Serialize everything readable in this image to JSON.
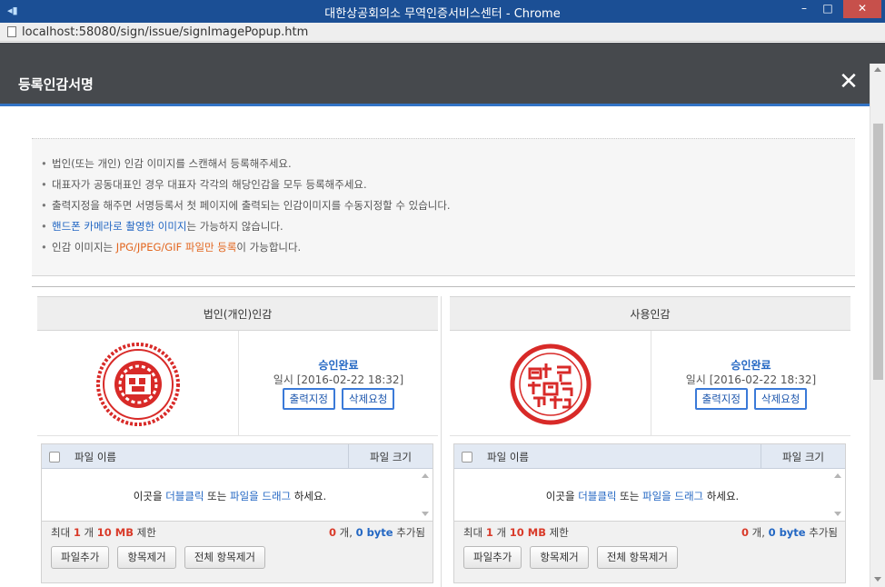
{
  "window": {
    "title": "대한상공회의소 무역인증서비스센터 - Chrome",
    "url": "localhost:58080/sign/issue/signImagePopup.htm",
    "min_glyph": "–",
    "max_glyph": "□",
    "close_glyph": "✕"
  },
  "popup": {
    "title": "등록인감서명",
    "close_glyph": "✕"
  },
  "notice": [
    {
      "parts": [
        {
          "t": "법인(또는 개인) 인감 이미지를 스캔해서 등록해주세요.",
          "c": ""
        }
      ]
    },
    {
      "parts": [
        {
          "t": "대표자가 공동대표인 경우 대표자 각각의 해당인감을 모두 등록해주세요.",
          "c": ""
        }
      ]
    },
    {
      "parts": [
        {
          "t": "출력지정을 해주면 서명등록서 첫 페이지에 출력되는 인감이미지를 수동지정할 수 있습니다.",
          "c": ""
        }
      ]
    },
    {
      "parts": [
        {
          "t": "핸드폰 카메라로 촬영한 이미지",
          "c": "blue"
        },
        {
          "t": "는 가능하지 않습니다.",
          "c": ""
        }
      ]
    },
    {
      "parts": [
        {
          "t": "인감 이미지는 ",
          "c": ""
        },
        {
          "t": "JPG/JPEG/GIF 파일만 등록",
          "c": "orange"
        },
        {
          "t": "이 가능합니다.",
          "c": ""
        }
      ]
    }
  ],
  "panels": [
    {
      "heading": "법인(개인)인감",
      "status": "승인완료",
      "datetime": "일시 [2016-02-22 18:32]",
      "print_button": "출력지정",
      "delete_button": "삭제요청",
      "file_table": {
        "col_name": "파일 이름",
        "col_size": "파일 크기",
        "drop_prefix": "이곳을 ",
        "drop_dblclick": "더블클릭",
        "drop_mid": " 또는 ",
        "drop_drag": "파일을 드래그",
        "drop_suffix": " 하세요.",
        "limit_prefix": "최대 ",
        "limit_count": "1",
        "limit_mid": " 개 ",
        "limit_size": "10 MB",
        "limit_suffix": " 제한",
        "added_count": "0",
        "added_mid": " 개, ",
        "added_bytes": "0 byte",
        "added_suffix": " 추가됨",
        "add_button": "파일추가",
        "remove_button": "항목제거",
        "remove_all_button": "전체 항목제거"
      }
    },
    {
      "heading": "사용인감",
      "status": "승인완료",
      "datetime": "일시 [2016-02-22 18:32]",
      "print_button": "출력지정",
      "delete_button": "삭제요청",
      "file_table": {
        "col_name": "파일 이름",
        "col_size": "파일 크기",
        "drop_prefix": "이곳을 ",
        "drop_dblclick": "더블클릭",
        "drop_mid": " 또는 ",
        "drop_drag": "파일을 드래그",
        "drop_suffix": " 하세요.",
        "limit_prefix": "최대 ",
        "limit_count": "1",
        "limit_mid": " 개 ",
        "limit_size": "10 MB",
        "limit_suffix": " 제한",
        "added_count": "0",
        "added_mid": " 개, ",
        "added_bytes": "0 byte",
        "added_suffix": " 추가됨",
        "add_button": "파일추가",
        "remove_button": "항목제거",
        "remove_all_button": "전체 항목제거"
      }
    }
  ],
  "colors": {
    "titlebar": "#1b4f95",
    "header": "#46494d",
    "accent": "#3273c5",
    "seal_red": "#d82a28"
  }
}
